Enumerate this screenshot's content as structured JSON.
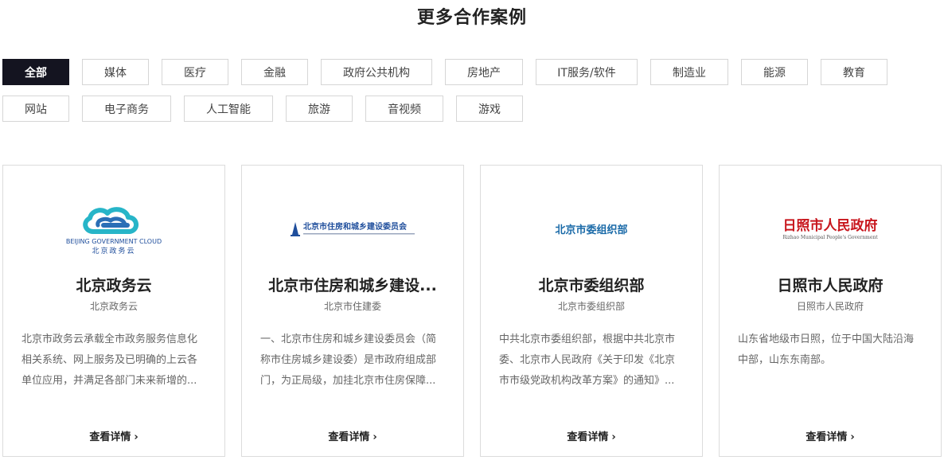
{
  "section_title": "更多合作案例",
  "filters": {
    "row1": [
      "全部",
      "媒体",
      "医疗",
      "金融",
      "政府公共机构",
      "房地产",
      "IT服务/软件",
      "制造业",
      "能源",
      "教育"
    ],
    "row2": [
      "网站",
      "电子商务",
      "人工智能",
      "旅游",
      "音视频",
      "游戏"
    ],
    "active": "全部"
  },
  "cards": [
    {
      "logo_en": "BEIJING GOVERNMENT CLOUD",
      "logo_cn": "北京政务云",
      "title": "北京政务云",
      "subtitle": "北京政务云",
      "desc": "北京市政务云承载全市政务服务信息化相关系统、网上服务及已明确的上云各单位应用，并满足各部门未来新增的...",
      "link": "查看详情"
    },
    {
      "logo_cn": "北京市住房和城乡建设委员会",
      "title": "北京市住房和城乡建设...",
      "subtitle": "北京市住建委",
      "desc": "一、北京市住房和城乡建设委员会（简称市住房城乡建设委）是市政府组成部门，为正局级，加挂北京市住房保障...",
      "link": "查看详情"
    },
    {
      "logo_cn": "北京市委组织部",
      "title": "北京市委组织部",
      "subtitle": "北京市委组织部",
      "desc": "中共北京市委组织部，根据中共北京市委、北京市人民政府《关于印发《北京市市级党政机构改革方案》的通知》...",
      "link": "查看详情"
    },
    {
      "logo_cn": "日照市人民政府",
      "logo_en": "Rizhao Municipal People's Government",
      "title": "日照市人民政府",
      "subtitle": "日照市人民政府",
      "desc": "山东省地级市日照，位于中国大陆沿海中部，山东东南部。",
      "link": "查看详情"
    }
  ],
  "colors": {
    "active_tag_bg": "#141420",
    "cloud_logo_blue": "#2b6fb6",
    "cloud_logo_cyan": "#27b5c8",
    "zjw_logo_blue": "#1f4e9c",
    "zzb_logo_blue": "#1a6aa8",
    "rizhao_logo_red": "#c8161d"
  }
}
